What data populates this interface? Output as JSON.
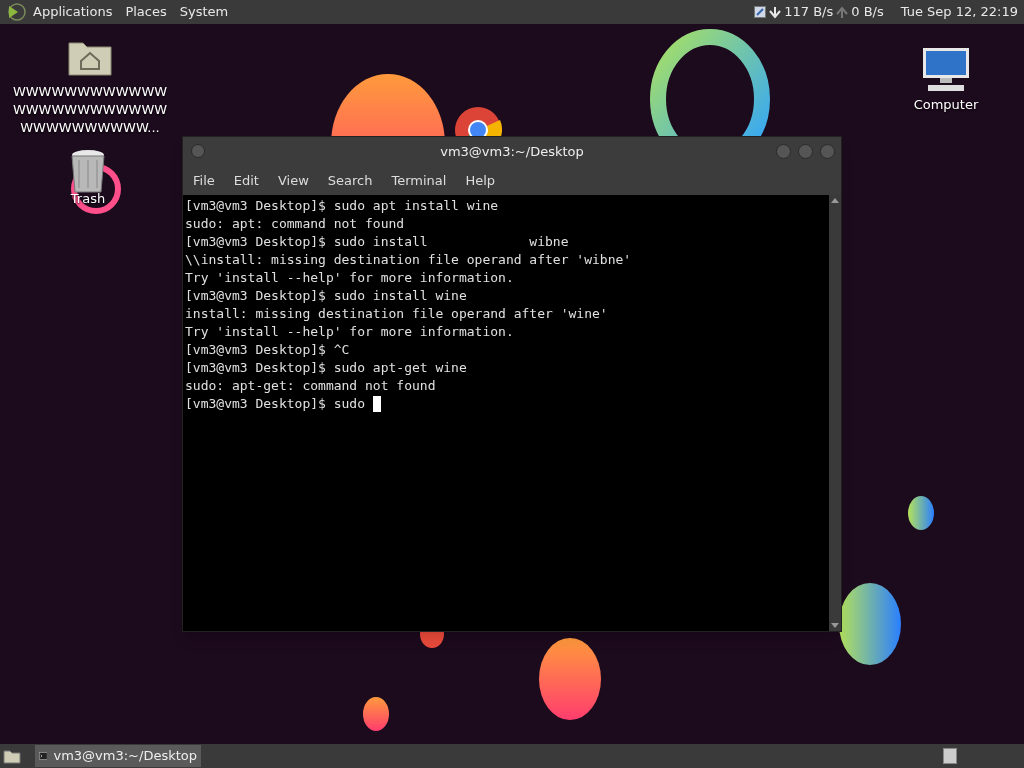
{
  "top_panel": {
    "menus": [
      "Applications",
      "Places",
      "System"
    ],
    "download_speed": "117 B/s",
    "upload_speed": "0 B/s",
    "clock": "Tue Sep 12, 22:19"
  },
  "desktop_icons": [
    {
      "kind": "home",
      "label": "WWWWWWWWWWWW WWWWWWWWWWWW WWWWWWWWWW..."
    },
    {
      "kind": "trash",
      "label": "Trash"
    },
    {
      "kind": "computer",
      "label": "Computer"
    }
  ],
  "terminal": {
    "title": "vm3@vm3:~/Desktop",
    "menu": [
      "File",
      "Edit",
      "View",
      "Search",
      "Terminal",
      "Help"
    ],
    "lines": [
      "[vm3@vm3 Desktop]$ sudo apt install wine",
      "sudo: apt: command not found",
      "[vm3@vm3 Desktop]$ sudo install             wibne",
      "\\\\install: missing destination file operand after 'wibne'",
      "Try 'install --help' for more information.",
      "[vm3@vm3 Desktop]$ sudo install wine",
      "install: missing destination file operand after 'wine'",
      "Try 'install --help' for more information.",
      "[vm3@vm3 Desktop]$ ^C",
      "[vm3@vm3 Desktop]$ sudo apt-get wine",
      "sudo: apt-get: command not found",
      "[vm3@vm3 Desktop]$ sudo "
    ],
    "cursor": true
  },
  "taskbar": {
    "windows": [
      {
        "label": "vm3@vm3:~/Desktop",
        "selected": true
      }
    ]
  }
}
